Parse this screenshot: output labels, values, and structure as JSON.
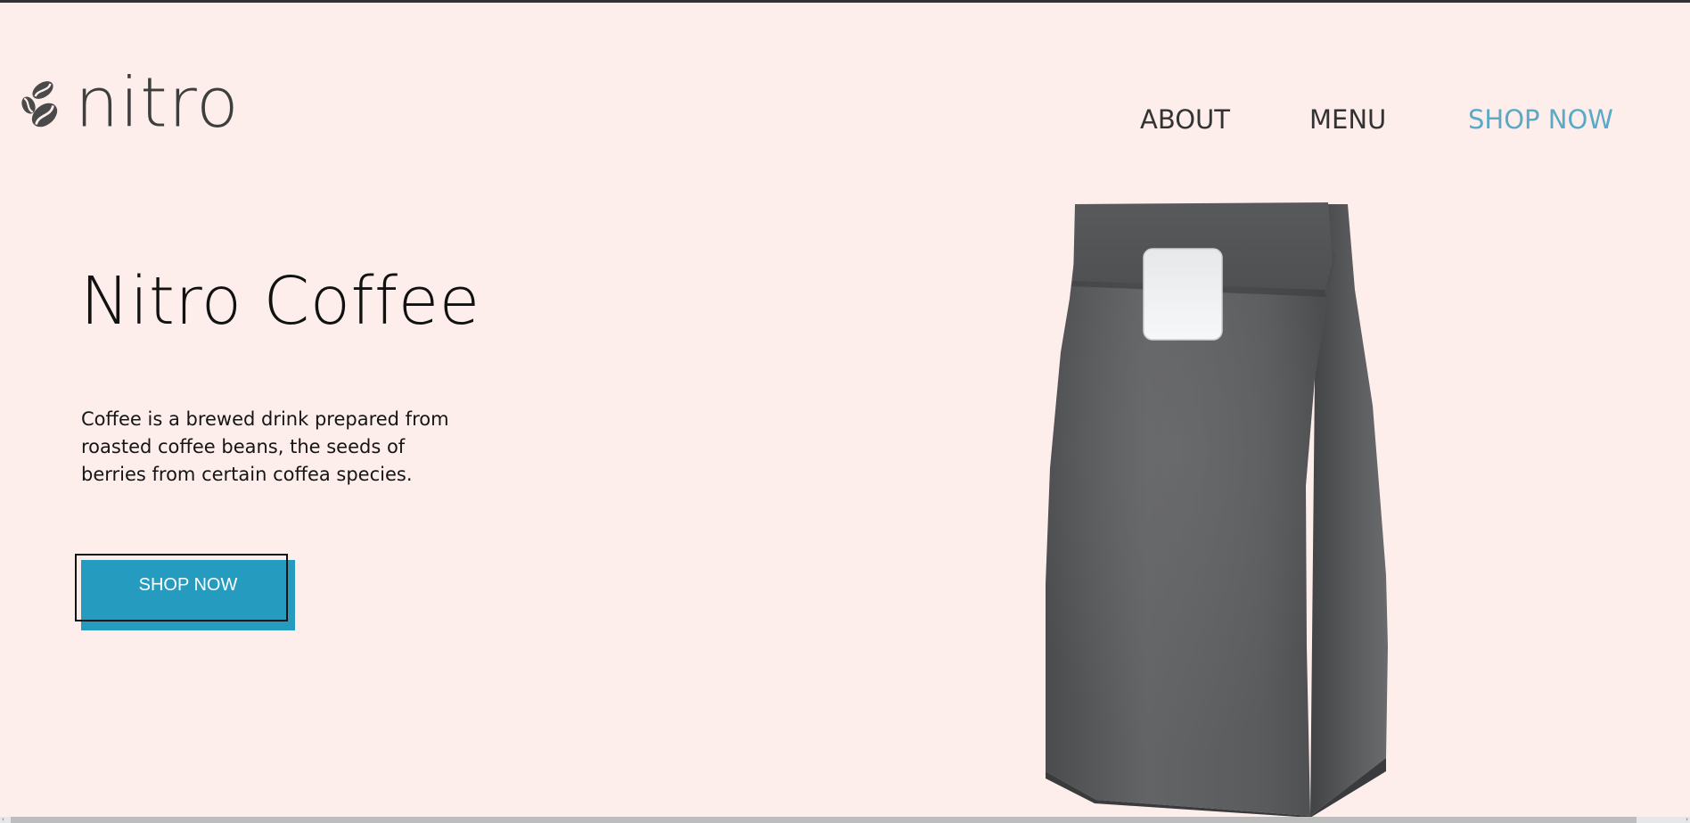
{
  "brand": {
    "name": "nitro",
    "icon": "coffee-beans-icon"
  },
  "nav": {
    "items": [
      {
        "label": "ABOUT"
      },
      {
        "label": "MENU"
      },
      {
        "label": "SHOP NOW",
        "active": true
      }
    ],
    "accent_color": "#5aa9c6"
  },
  "hero": {
    "title": "Nitro Coffee",
    "description": "Coffee is a brewed drink prepared from roasted coffee beans, the seeds of berries from certain coffea species.",
    "cta_label": "SHOP NOW",
    "cta_color": "#269bc0"
  },
  "product": {
    "icon": "coffee-bag-image"
  },
  "colors": {
    "background": "#fdeeec",
    "text": "#333333"
  },
  "scrollbar": {
    "icon_left": "scroll-left-arrow-icon",
    "icon_right": "scroll-right-arrow-icon"
  }
}
